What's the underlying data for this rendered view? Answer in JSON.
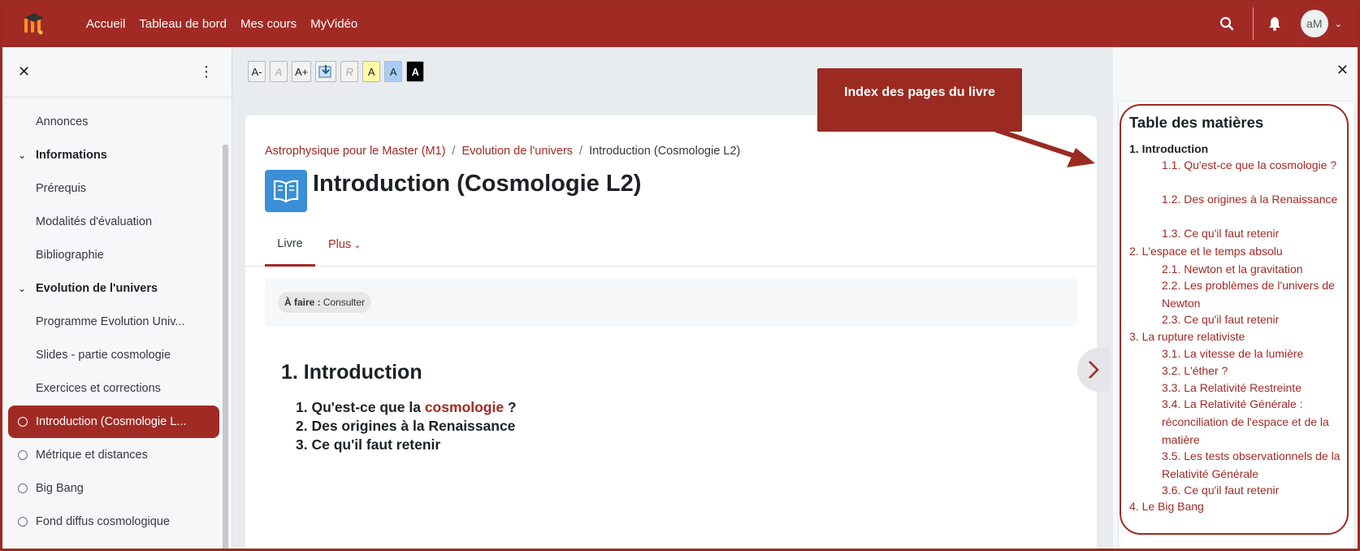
{
  "navbar": {
    "links": [
      "Accueil",
      "Tableau de bord",
      "Mes cours",
      "MyVidéo"
    ],
    "avatar_initials": "aM"
  },
  "drawer": {
    "items": [
      {
        "label": "Annonces",
        "kind": "indent"
      },
      {
        "label": "Informations",
        "kind": "section"
      },
      {
        "label": "Prérequis",
        "kind": "indent"
      },
      {
        "label": "Modalités d'évaluation",
        "kind": "indent"
      },
      {
        "label": "Bibliographie",
        "kind": "indent"
      },
      {
        "label": "Evolution de l'univers",
        "kind": "section"
      },
      {
        "label": "Programme Evolution Univ...",
        "kind": "indent"
      },
      {
        "label": "Slides - partie cosmologie",
        "kind": "indent"
      },
      {
        "label": "Exercices et corrections",
        "kind": "indent"
      },
      {
        "label": "Introduction (Cosmologie L...",
        "kind": "act",
        "current": true
      },
      {
        "label": "Métrique et distances",
        "kind": "act"
      },
      {
        "label": "Big Bang",
        "kind": "act"
      },
      {
        "label": "Fond diffus cosmologique",
        "kind": "act"
      }
    ]
  },
  "toolbar": {
    "buttons": [
      "A-",
      "A",
      "A+",
      "",
      "R",
      "A",
      "A",
      "A"
    ]
  },
  "breadcrumb": {
    "items": [
      "Astrophysique pour le Master (M1)",
      "Evolution de l'univers",
      "Introduction (Cosmologie L2)"
    ]
  },
  "page": {
    "title": "Introduction (Cosmologie L2)",
    "tabs": [
      "Livre",
      "Plus"
    ],
    "todo_label": "À faire :",
    "todo_value": "Consulter",
    "chapter_title": "1. Introduction",
    "chapter_items": [
      {
        "prefix": "1. Qu'est-ce que la ",
        "link": "cosmologie",
        "suffix": " ?"
      },
      {
        "prefix": "2. Des origines à la Renaissance"
      },
      {
        "prefix": "3. Ce qu'il faut retenir"
      }
    ]
  },
  "callout": {
    "text": "Index des pages du livre"
  },
  "toc": {
    "title": "Table des matières",
    "items": [
      {
        "text": "1. Introduction",
        "level": 1
      },
      {
        "text": "1.1. Qu'est-ce que la cosmologie ?",
        "level": 2
      },
      {
        "text": "1.2. Des origines à la Renaissance",
        "level": 2
      },
      {
        "text": "1.3. Ce qu'il faut retenir",
        "level": 2
      },
      {
        "text": "2. L'espace et le temps absolu",
        "level": 1
      },
      {
        "text": "2.1. Newton et la gravitation",
        "level": 2
      },
      {
        "text": "2.2. Les problèmes de l'univers de Newton",
        "level": 2
      },
      {
        "text": "2.3. Ce qu'il faut retenir",
        "level": 2
      },
      {
        "text": "3. La rupture relativiste",
        "level": 1
      },
      {
        "text": "3.1. La vitesse de la lumière",
        "level": 2
      },
      {
        "text": "3.2. L'éther ?",
        "level": 2
      },
      {
        "text": "3.3. La Relativité Restreinte",
        "level": 2
      },
      {
        "text": "3.4. La Relativité Générale : réconciliation de l'espace et de la matière",
        "level": 2
      },
      {
        "text": "3.5. Les tests observationnels de la Relativité Générale",
        "level": 2
      },
      {
        "text": "3.6. Ce qu'il faut retenir",
        "level": 2
      },
      {
        "text": "4. Le Big Bang",
        "level": 1
      }
    ]
  },
  "colors": {
    "brand": "#a12a25",
    "annotation": "#9b2a22"
  }
}
